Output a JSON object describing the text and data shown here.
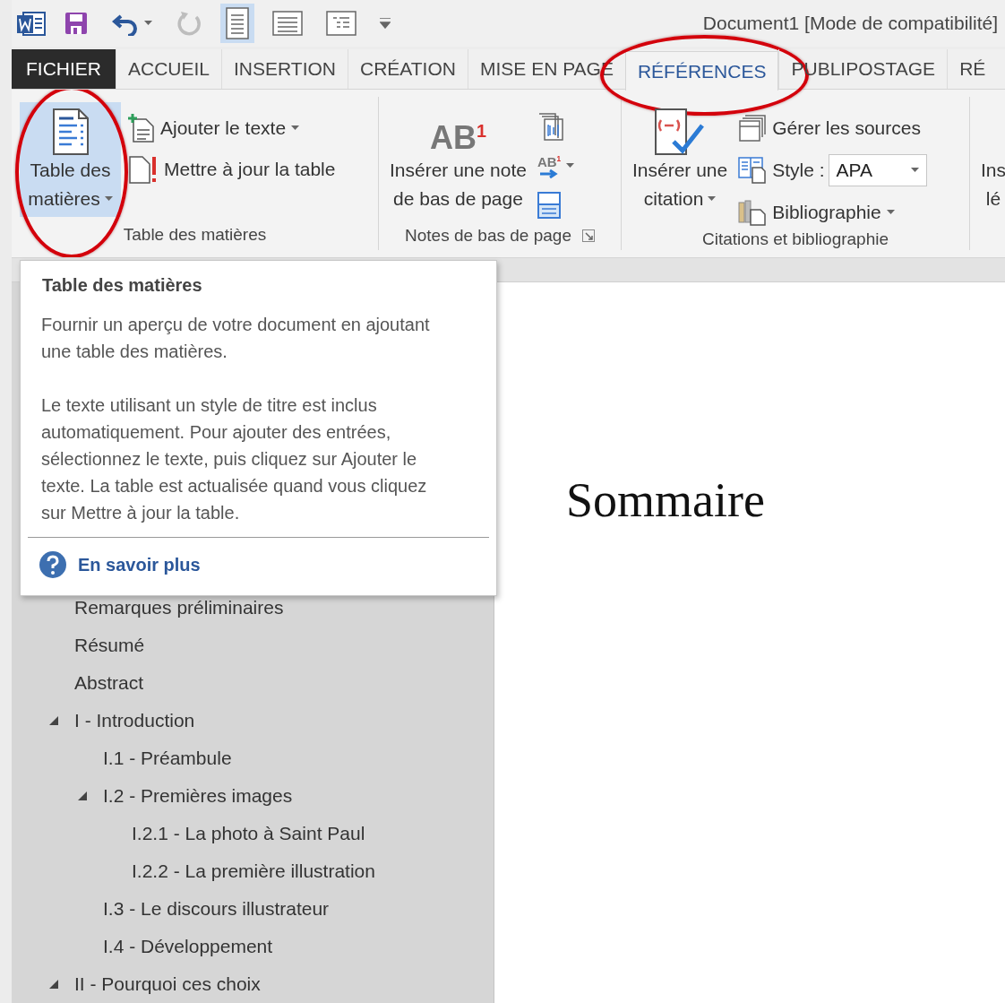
{
  "title_bar": {
    "quick_access": [
      {
        "kind": "save",
        "disabled": false
      },
      {
        "kind": "undo",
        "disabled": false
      },
      {
        "kind": "redo",
        "disabled": true
      }
    ],
    "view_buttons": [
      {
        "kind": "print",
        "selected": true
      },
      {
        "kind": "read",
        "selected": false
      },
      {
        "kind": "outline",
        "selected": false
      }
    ],
    "title": "Document1 [Mode de compatibilité]"
  },
  "tabs": [
    {
      "label": "FICHIER",
      "kind": "file",
      "selected": false,
      "circled": false
    },
    {
      "label": "ACCUEIL",
      "kind": "tab",
      "selected": false,
      "circled": false
    },
    {
      "label": "INSERTION",
      "kind": "tab",
      "selected": false,
      "circled": false
    },
    {
      "label": "CRÉATION",
      "kind": "tab",
      "selected": false,
      "circled": false
    },
    {
      "label": "MISE EN PAGE",
      "kind": "tab",
      "selected": false,
      "circled": false
    },
    {
      "label": "RÉFÉRENCES",
      "kind": "tab",
      "selected": true,
      "circled": true
    },
    {
      "label": "PUBLIPOSTAGE",
      "kind": "tab",
      "selected": false,
      "circled": false
    },
    {
      "label": "RÉ",
      "kind": "tab",
      "selected": false,
      "circled": false
    }
  ],
  "ribbon": {
    "groups": [
      {
        "label": "Table des matières",
        "large": {
          "lines": [
            "Table des",
            "matières"
          ],
          "kind": "toc",
          "dropdown": true,
          "selected": true,
          "circled": true
        },
        "small": [
          {
            "label": "Ajouter le texte",
            "kind": "add-text",
            "dropdown": true
          },
          {
            "label": "Mettre à jour la table",
            "kind": "update"
          }
        ]
      },
      {
        "label": "Notes de bas de page",
        "launcher": true,
        "large": {
          "lines": [
            "Insérer une note",
            "de bas de page"
          ],
          "kind": "footnote",
          "icon_label": "AB$^{1}$",
          "selected": false,
          "circled": false
        },
        "small": [
          {
            "kind": "endnote"
          },
          {
            "kind": "next-note",
            "icon_label": "AB$^{1}$",
            "dropdown": true
          },
          {
            "kind": "show-notes"
          }
        ]
      },
      {
        "label": "Citations et bibliographie",
        "large": {
          "lines": [
            "Insérer une",
            "citation"
          ],
          "kind": "citation",
          "dropdown": true,
          "selected": false,
          "circled": false
        },
        "small": [
          {
            "label": "Gérer les sources",
            "kind": "sources"
          },
          {
            "label": "Style :",
            "kind": "style",
            "value": "APA"
          },
          {
            "label": "Bibliographie",
            "kind": "bibliography",
            "dropdown": true
          }
        ]
      },
      {
        "large": {
          "lines": [
            "Ins",
            "lé"
          ],
          "kind": "cut",
          "selected": false,
          "circled": false
        }
      }
    ]
  },
  "tooltip": {
    "title": "Table des matières",
    "paragraphs": [
      "Fournir un aperçu de votre document en ajoutant une table des matières.",
      "Le texte utilisant un style de titre est inclus automatiquement. Pour ajouter des entrées, sélectionnez le texte, puis cliquez sur Ajouter le texte. La table est actualisée quand vous cliquez sur Mettre à jour la table."
    ],
    "link": "En savoir plus"
  },
  "navigation": {
    "items": [
      {
        "label": "Remarques préliminaires"
      },
      {
        "label": "Résumé"
      },
      {
        "label": "Abstract"
      },
      {
        "label": "I - Introduction",
        "expanded": true,
        "children": [
          {
            "label": "I.1 -  Préambule"
          },
          {
            "label": "I.2 - Premières images",
            "expanded": true,
            "children": [
              {
                "label": "I.2.1 - La photo à Saint Paul"
              },
              {
                "label": "I.2.2 - La première illustration"
              }
            ]
          },
          {
            "label": "I.3 -  Le discours illustrateur"
          },
          {
            "label": "I.4 - Développement"
          }
        ]
      },
      {
        "label": "II - Pourquoi ces choix",
        "expanded": true
      }
    ]
  },
  "document": {
    "heading": "Sommaire"
  }
}
